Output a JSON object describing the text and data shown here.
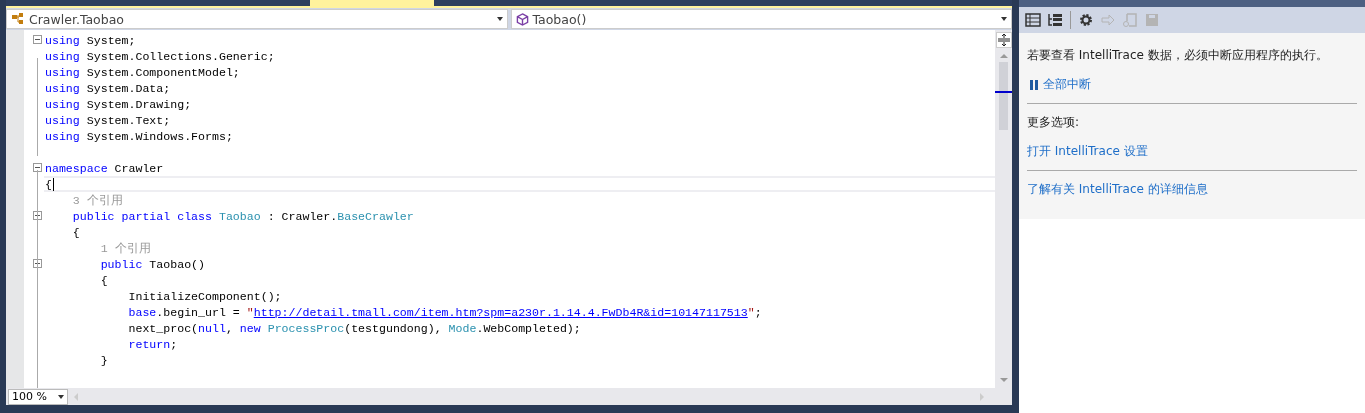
{
  "navigation_bar": {
    "type_dropdown": "Crawler.Taobao",
    "member_dropdown": "Taobao()"
  },
  "editor": {
    "lines": [
      {
        "kind": "collapsible",
        "tokens": [
          {
            "kind": "kw",
            "text": "using"
          },
          {
            "kind": "plain",
            "text": " System;"
          }
        ]
      },
      {
        "kind": "code",
        "tokens": [
          {
            "kind": "kw",
            "text": "using"
          },
          {
            "kind": "plain",
            "text": " System.Collections.Generic;"
          }
        ]
      },
      {
        "kind": "code",
        "tokens": [
          {
            "kind": "kw",
            "text": "using"
          },
          {
            "kind": "plain",
            "text": " System.ComponentModel;"
          }
        ]
      },
      {
        "kind": "code",
        "tokens": [
          {
            "kind": "kw",
            "text": "using"
          },
          {
            "kind": "plain",
            "text": " System.Data;"
          }
        ]
      },
      {
        "kind": "code",
        "tokens": [
          {
            "kind": "kw",
            "text": "using"
          },
          {
            "kind": "plain",
            "text": " System.Drawing;"
          }
        ]
      },
      {
        "kind": "code",
        "tokens": [
          {
            "kind": "kw",
            "text": "using"
          },
          {
            "kind": "plain",
            "text": " System.Text;"
          }
        ]
      },
      {
        "kind": "code",
        "tokens": [
          {
            "kind": "kw",
            "text": "using"
          },
          {
            "kind": "plain",
            "text": " System.Windows.Forms;"
          }
        ]
      },
      {
        "kind": "blank"
      },
      {
        "kind": "collapsible",
        "tokens": [
          {
            "kind": "kw",
            "text": "namespace"
          },
          {
            "kind": "plain",
            "text": " Crawler"
          }
        ]
      },
      {
        "kind": "current",
        "tokens": [
          {
            "kind": "plain",
            "text": "{"
          }
        ]
      },
      {
        "kind": "lens",
        "tokens": [
          {
            "kind": "ref",
            "text": "    3 个引用"
          }
        ]
      },
      {
        "kind": "collapsible",
        "tokens": [
          {
            "kind": "kw",
            "text": "    public partial class"
          },
          {
            "kind": "type",
            "text": " Taobao"
          },
          {
            "kind": "plain",
            "text": " : Crawler."
          },
          {
            "kind": "type",
            "text": "BaseCrawler"
          }
        ]
      },
      {
        "kind": "code",
        "tokens": [
          {
            "kind": "plain",
            "text": "    {"
          }
        ]
      },
      {
        "kind": "lens",
        "tokens": [
          {
            "kind": "ref",
            "text": "        1 个引用"
          }
        ]
      },
      {
        "kind": "collapsible",
        "tokens": [
          {
            "kind": "kw",
            "text": "        public"
          },
          {
            "kind": "plain",
            "text": " Taobao()"
          }
        ]
      },
      {
        "kind": "code",
        "tokens": [
          {
            "kind": "plain",
            "text": "        {"
          }
        ]
      },
      {
        "kind": "code",
        "tokens": [
          {
            "kind": "plain",
            "text": "            InitializeComponent();"
          }
        ]
      },
      {
        "kind": "code",
        "tokens": [
          {
            "kind": "kw",
            "text": "            base"
          },
          {
            "kind": "plain",
            "text": ".begin_url = "
          },
          {
            "kind": "str",
            "text": "\""
          },
          {
            "kind": "link",
            "text": "http://detail.tmall.com/item.htm?spm=a230r.1.14.4.FwDb4R&id=10147117513"
          },
          {
            "kind": "str",
            "text": "\""
          },
          {
            "kind": "plain",
            "text": ";"
          }
        ]
      },
      {
        "kind": "code",
        "tokens": [
          {
            "kind": "plain",
            "text": "            next_proc("
          },
          {
            "kind": "kw",
            "text": "null"
          },
          {
            "kind": "plain",
            "text": ", "
          },
          {
            "kind": "kw",
            "text": "new "
          },
          {
            "kind": "type",
            "text": "ProcessProc"
          },
          {
            "kind": "plain",
            "text": "(testgundong), "
          },
          {
            "kind": "type",
            "text": "Mode"
          },
          {
            "kind": "plain",
            "text": ".WebCompleted);"
          }
        ]
      },
      {
        "kind": "code",
        "tokens": [
          {
            "kind": "kw",
            "text": "            return"
          },
          {
            "kind": "plain",
            "text": ";"
          }
        ]
      },
      {
        "kind": "code",
        "tokens": [
          {
            "kind": "plain",
            "text": "        }"
          }
        ]
      }
    ],
    "zoom": "100 %"
  },
  "intellitrace": {
    "toolbar": [
      {
        "kind": "list",
        "disabled": false
      },
      {
        "kind": "tree",
        "disabled": false
      },
      {
        "kind": "separator"
      },
      {
        "kind": "gear",
        "disabled": false
      },
      {
        "kind": "arrow",
        "disabled": true
      },
      {
        "kind": "export",
        "disabled": true
      },
      {
        "kind": "save",
        "disabled": true
      }
    ],
    "message": "若要查看 IntelliTrace 数据，必须中断应用程序的执行。",
    "break_all": "全部中断",
    "more_options": "更多选项:",
    "open_settings": "打开 IntelliTrace 设置",
    "learn_more": "了解有关 IntelliTrace 的详细信息"
  }
}
